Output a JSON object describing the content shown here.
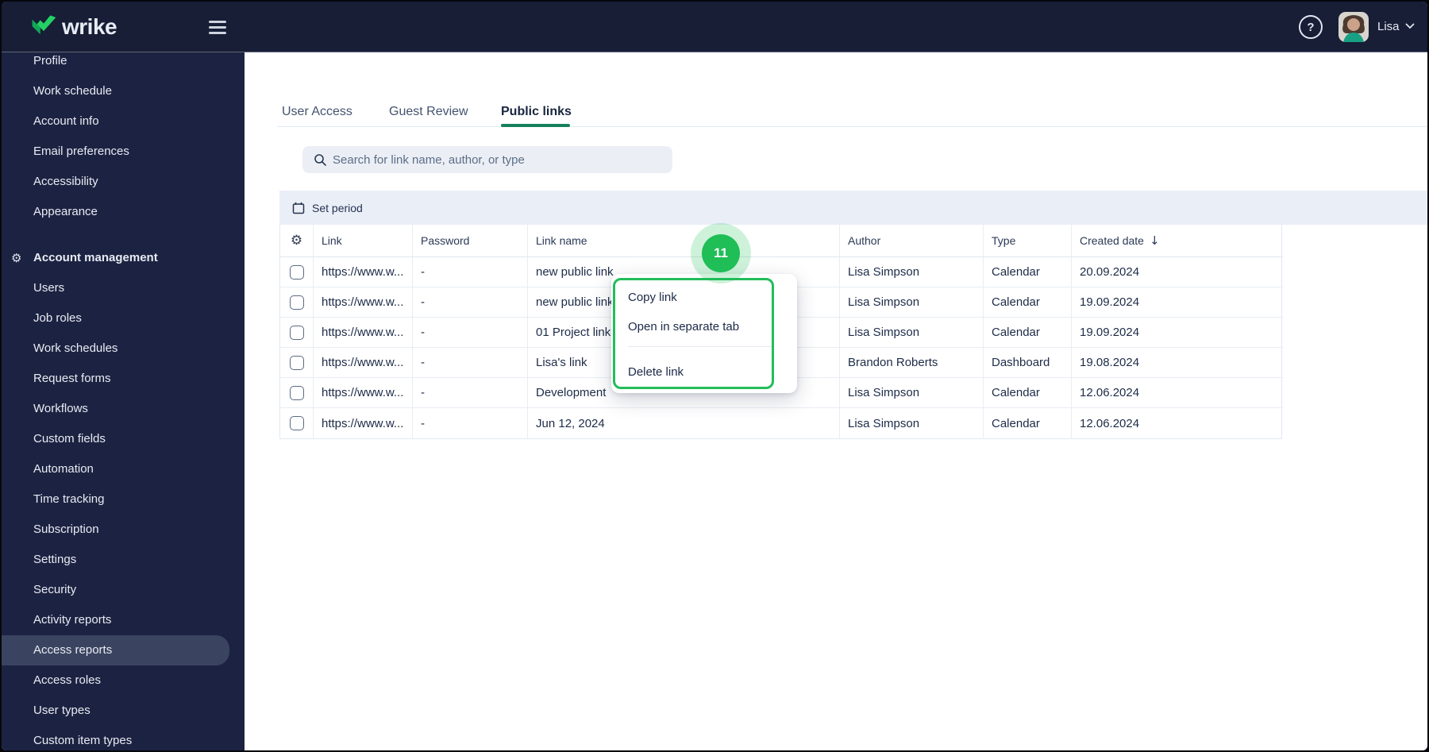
{
  "topbar": {
    "logo_text": "wrike",
    "help_label": "?",
    "user": {
      "name": "Lisa"
    }
  },
  "sidebar": {
    "items": [
      {
        "label": "Profile"
      },
      {
        "label": "Work schedule"
      },
      {
        "label": "Account info"
      },
      {
        "label": "Email preferences"
      },
      {
        "label": "Accessibility"
      },
      {
        "label": "Appearance"
      },
      {
        "label": "Account management",
        "section": true
      },
      {
        "label": "Users"
      },
      {
        "label": "Job roles"
      },
      {
        "label": "Work schedules"
      },
      {
        "label": "Request forms"
      },
      {
        "label": "Workflows"
      },
      {
        "label": "Custom fields"
      },
      {
        "label": "Automation"
      },
      {
        "label": "Time tracking"
      },
      {
        "label": "Subscription"
      },
      {
        "label": "Settings"
      },
      {
        "label": "Security"
      },
      {
        "label": "Activity reports"
      },
      {
        "label": "Access reports",
        "selected": true
      },
      {
        "label": "Access roles"
      },
      {
        "label": "User types"
      },
      {
        "label": "Custom item types"
      }
    ]
  },
  "tabs": [
    {
      "label": "User Access",
      "active": false
    },
    {
      "label": "Guest Review",
      "active": false
    },
    {
      "label": "Public links",
      "active": true
    }
  ],
  "search": {
    "placeholder": "Search for link name, author, or type"
  },
  "toolbar": {
    "set_period_label": "Set period"
  },
  "table": {
    "headers": {
      "link": "Link",
      "password": "Password",
      "link_name": "Link name",
      "author": "Author",
      "type": "Type",
      "created": "Created date",
      "sort_icon": "↓"
    },
    "rows": [
      {
        "link": "https://www.w...",
        "password": "-",
        "name": "new public link",
        "author": "Lisa Simpson",
        "type": "Calendar",
        "created": "20.09.2024"
      },
      {
        "link": "https://www.w...",
        "password": "-",
        "name": "new public link",
        "author": "Lisa Simpson",
        "type": "Calendar",
        "created": "19.09.2024"
      },
      {
        "link": "https://www.w...",
        "password": "-",
        "name": "01 Project link",
        "author": "Lisa Simpson",
        "type": "Calendar",
        "created": "19.09.2024"
      },
      {
        "link": "https://www.w...",
        "password": "-",
        "name": "Lisa's link",
        "author": "Brandon Roberts",
        "type": "Dashboard",
        "created": "19.08.2024"
      },
      {
        "link": "https://www.w...",
        "password": "-",
        "name": "Development",
        "author": "Lisa Simpson",
        "type": "Calendar",
        "created": "12.06.2024"
      },
      {
        "link": "https://www.w...",
        "password": "-",
        "name": "Jun 12, 2024",
        "author": "Lisa Simpson",
        "type": "Calendar",
        "created": "12.06.2024"
      }
    ]
  },
  "context_menu": {
    "items": [
      {
        "label": "Copy link"
      },
      {
        "label": "Open in separate tab"
      },
      {
        "label": "Delete link"
      }
    ]
  },
  "annotation": {
    "step_number": "11"
  },
  "colors": {
    "topbar_bg": "#171e36",
    "sidebar_bg": "#1c2342",
    "selected_item_bg": "#3a4460",
    "accent_green": "#1fbe57",
    "tab_underline_green": "#15805c",
    "menu_border_green": "#22bd5a",
    "toolbar_bg": "#eaeef7"
  }
}
